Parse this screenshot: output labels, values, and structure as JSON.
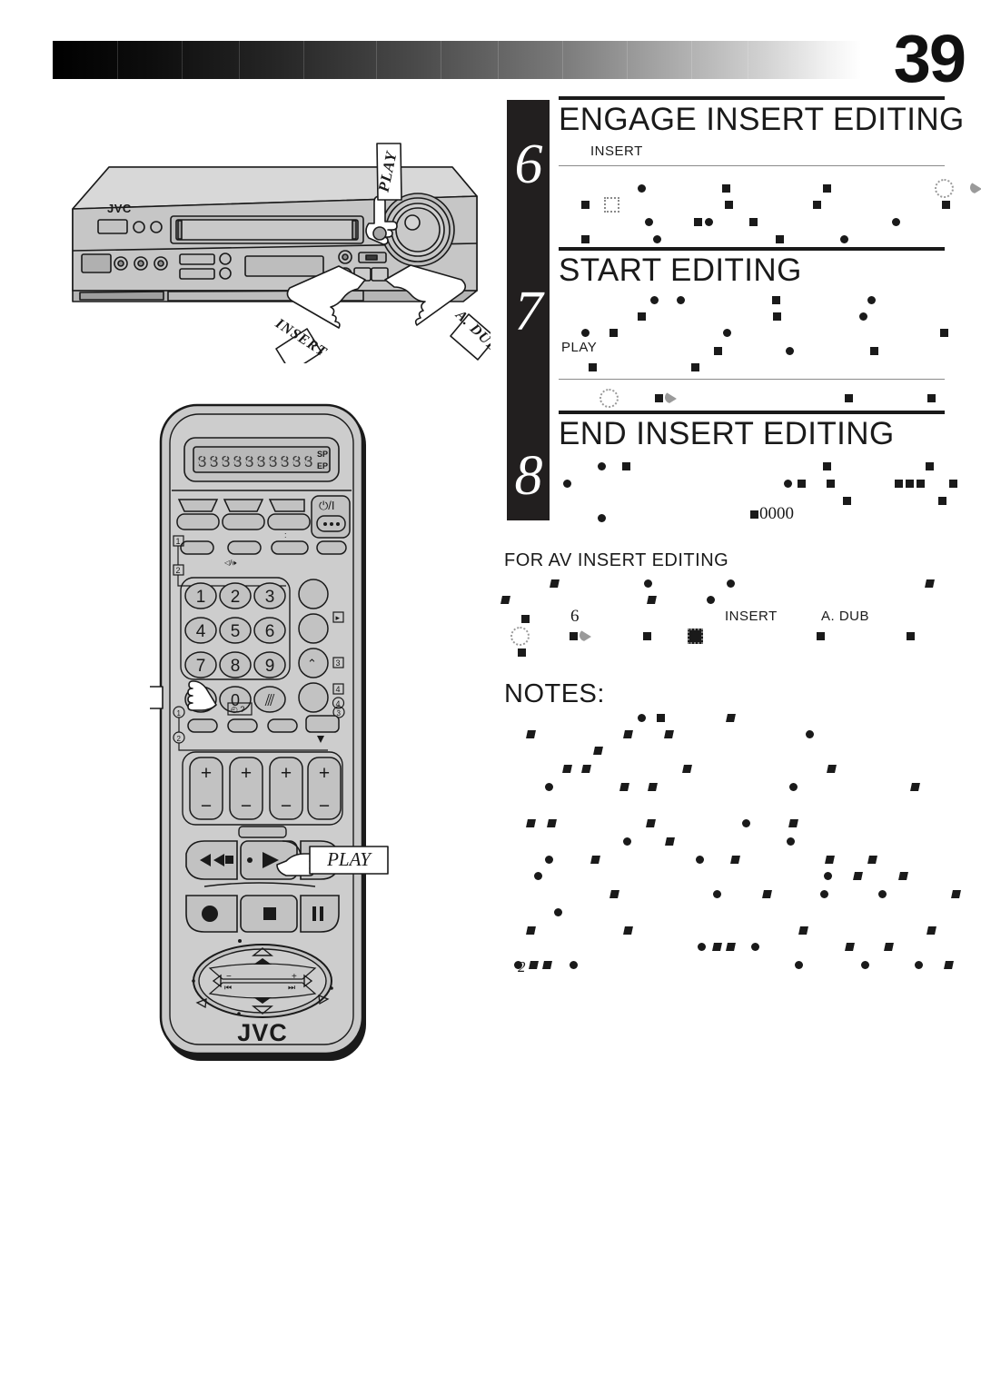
{
  "page": {
    "number": "39",
    "footer_number": "2"
  },
  "steps": [
    {
      "number": "6",
      "heading": "ENGAGE INSERT EDITING",
      "sublabel": "INSERT"
    },
    {
      "number": "7",
      "heading": "START EDITING",
      "sublabel": "PLAY"
    },
    {
      "number": "8",
      "heading": "END INSERT EDITING",
      "inline_value": "0000"
    }
  ],
  "sections": {
    "av_insert": {
      "label": "FOR AV INSERT EDITING",
      "step_ref": "6",
      "button_insert": "INSERT",
      "button_adub": "A. DUB"
    },
    "notes": {
      "label": "NOTES:"
    }
  },
  "vcr": {
    "brand": "JVC",
    "power_label": "⏻",
    "callouts": {
      "play": "PLAY",
      "insert": "INSERT",
      "adub": "A. DUB"
    }
  },
  "remote": {
    "brand": "JVC",
    "display": {
      "digits": "0000000000",
      "mode_sp": "SP",
      "mode_ep": "EP"
    },
    "power_label": "⏻/I",
    "keypad": [
      "1",
      "2",
      "3",
      "4",
      "5",
      "6",
      "7",
      "8",
      "9",
      "0"
    ],
    "cancel_key": "✕",
    "markers": [
      "1",
      "2",
      "3",
      "4"
    ],
    "circle_markers": [
      "1",
      "2",
      "3",
      "4"
    ],
    "callouts": {
      "zero_code": "0000",
      "play": "PLAY"
    }
  },
  "colors": {
    "ink": "#1a1a1a",
    "step_bar": "#221f1f",
    "body_gray": "#c9c9c9",
    "panel_gray": "#b8b8b8",
    "dark_gray": "#8a8a8a"
  }
}
